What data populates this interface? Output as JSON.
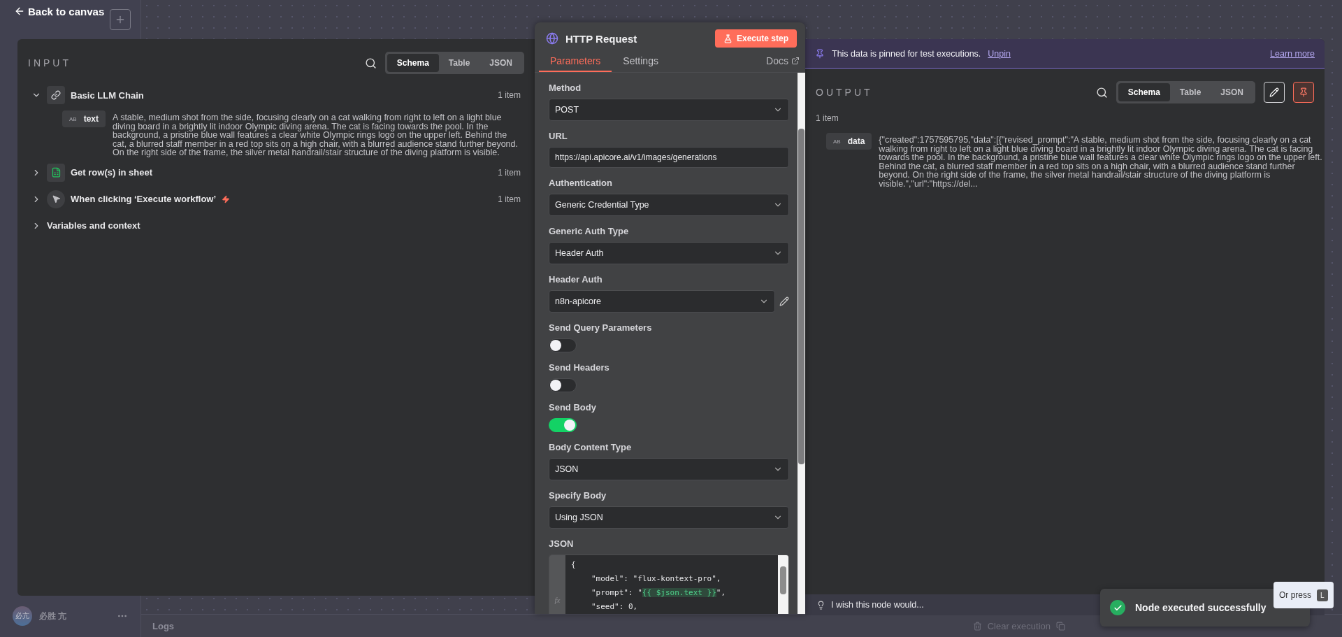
{
  "back": {
    "label": "Back to canvas"
  },
  "sidebar": {
    "user_initials": "必亢",
    "user_name": "必胜 亢"
  },
  "logs": {
    "title": "Logs",
    "clear": "Clear execution"
  },
  "input": {
    "title": "INPUT",
    "views": [
      {
        "label": "Schema",
        "selected": true
      },
      {
        "label": "Table",
        "selected": false
      },
      {
        "label": "JSON",
        "selected": false
      }
    ],
    "nodes": [
      {
        "kind": "link",
        "name": "Basic LLM Chain",
        "count": "1 item",
        "expanded": true,
        "fields": [
          {
            "badge": "AB",
            "key": "text",
            "value": "A stable, medium shot from the side, focusing clearly on a cat walking from right to left on a light blue diving board in a brightly lit indoor Olympic diving arena. The cat is facing towards the pool. In the background, a pristine blue wall features a clear white Olympic rings logo on the upper left. Behind the cat, a blurred staff member in a red top sits on a high chair, with a blurred audience stand further beyond. On the right side of the frame, the silver metal handrail/stair structure of the diving platform is visible."
          }
        ]
      },
      {
        "kind": "sheet",
        "name": "Get row(s) in sheet",
        "count": "1 item",
        "expanded": false
      },
      {
        "kind": "trigger",
        "name": "When clicking ‘Execute workflow’",
        "count": "1 item",
        "expanded": false
      },
      {
        "kind": "context",
        "name": "Variables and context",
        "expanded": false
      }
    ]
  },
  "middle": {
    "title": "HTTP Request",
    "execute": "Execute step",
    "tabs": [
      {
        "label": "Parameters",
        "selected": true
      },
      {
        "label": "Settings",
        "selected": false
      }
    ],
    "docs": "Docs",
    "params": [
      {
        "kind": "select",
        "label": "Method",
        "value": "POST"
      },
      {
        "kind": "text",
        "label": "URL",
        "value": "https://api.apicore.ai/v1/images/generations"
      },
      {
        "kind": "select",
        "label": "Authentication",
        "value": "Generic Credential Type"
      },
      {
        "kind": "select",
        "label": "Generic Auth Type",
        "value": "Header Auth"
      },
      {
        "kind": "credential",
        "label": "Header Auth",
        "value": "n8n-apicore"
      },
      {
        "kind": "toggle",
        "label": "Send Query Parameters",
        "on": false
      },
      {
        "kind": "toggle",
        "label": "Send Headers",
        "on": false
      },
      {
        "kind": "toggle",
        "label": "Send Body",
        "on": true
      },
      {
        "kind": "select",
        "label": "Body Content Type",
        "value": "JSON"
      },
      {
        "kind": "select",
        "label": "Specify Body",
        "value": "Using JSON"
      },
      {
        "kind": "code",
        "label": "JSON",
        "fx": "fx",
        "lines": [
          {
            "indented": false,
            "parts": [
              {
                "kind": "plain",
                "text": "{"
              }
            ]
          },
          {
            "indented": true,
            "parts": [
              {
                "kind": "plain",
                "text": "\"model\": \"flux-kontext-pro\","
              }
            ]
          },
          {
            "indented": true,
            "parts": [
              {
                "kind": "plain",
                "text": "\"prompt\": \""
              },
              {
                "kind": "expression",
                "text": "{{ $json.text }}"
              },
              {
                "kind": "plain",
                "text": "\","
              }
            ]
          },
          {
            "indented": true,
            "parts": [
              {
                "kind": "plain",
                "text": "\"seed\": 0,"
              }
            ]
          }
        ]
      }
    ]
  },
  "output": {
    "banner": {
      "text": "This data is pinned for test executions.",
      "link": "Unpin",
      "learn": "Learn more"
    },
    "title": "OUTPUT",
    "pinned": true,
    "views": [
      {
        "label": "Schema",
        "selected": true
      },
      {
        "label": "Table",
        "selected": false
      },
      {
        "label": "JSON",
        "selected": false
      }
    ],
    "count": "1 item",
    "fields": [
      {
        "badge": "AB",
        "key": "data",
        "value": "{\"created\":1757595795,\"data\":[{\"revised_prompt\":\"A stable, medium shot from the side, focusing clearly on a cat walking from right to left on a light blue diving board in a brightly lit indoor Olympic diving arena. The cat is facing towards the pool. In the background, a pristine blue wall features a clear white Olympic rings logo on the upper left. Behind the cat, a blurred staff member in a red top sits on a high chair, with a blurred audience stand further beyond. On the right side of the frame, the silver metal handrail/stair structure of the diving platform is visible.\",\"url\":\"https://del..."
      }
    ],
    "hint": "I wish this node would..."
  },
  "toast": {
    "message": "Node executed successfully"
  },
  "tooltip": {
    "text": "Or press",
    "key": "L"
  }
}
